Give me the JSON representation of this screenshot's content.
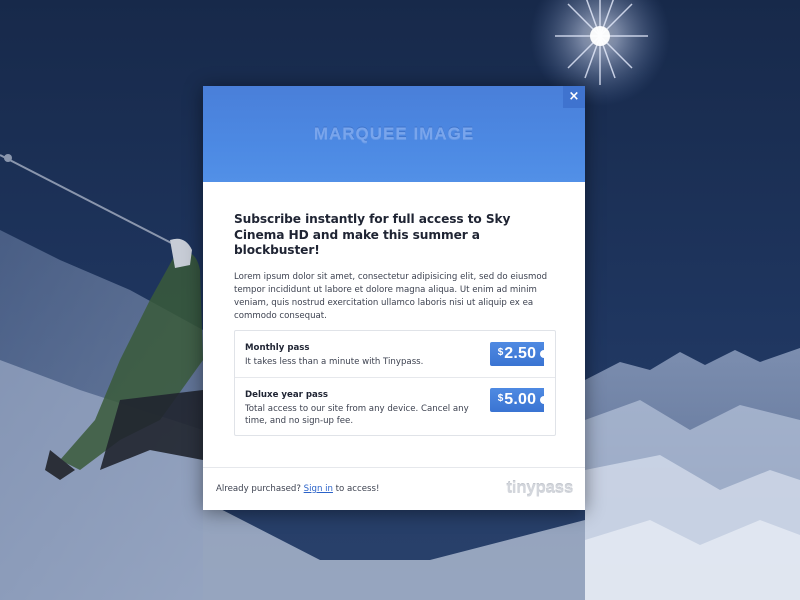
{
  "modal": {
    "marquee_text": "MARQUEE IMAGE",
    "close_label": "×",
    "headline": "Subscribe instantly for full access to Sky Cinema HD and make this summer a blockbuster!",
    "body": "Lorem ipsum dolor sit amet, consectetur adipisicing elit, sed do eiusmod tempor incididunt ut labore et dolore magna aliqua. Ut enim ad minim veniam, quis nostrud exercitation ullamco laboris nisi ut aliquip ex ea commodo consequat.",
    "plans": [
      {
        "name": "Monthly pass",
        "description": "It takes less than a minute with Tinypass.",
        "currency": "$",
        "amount": "2.50"
      },
      {
        "name": "Deluxe year pass",
        "description": "Total access to our site from any device. Cancel any time, and no sign-up fee.",
        "currency": "$",
        "amount": "5.00"
      }
    ],
    "footer": {
      "prefix": "Already purchased? ",
      "link_text": "Sign in",
      "suffix": " to access!"
    },
    "brand": "tinypass"
  },
  "colors": {
    "marquee_blue": "#4c89e3",
    "price_blue": "#3f7ad6",
    "link_blue": "#2a62c9",
    "background_navy": "#1c2f52"
  }
}
